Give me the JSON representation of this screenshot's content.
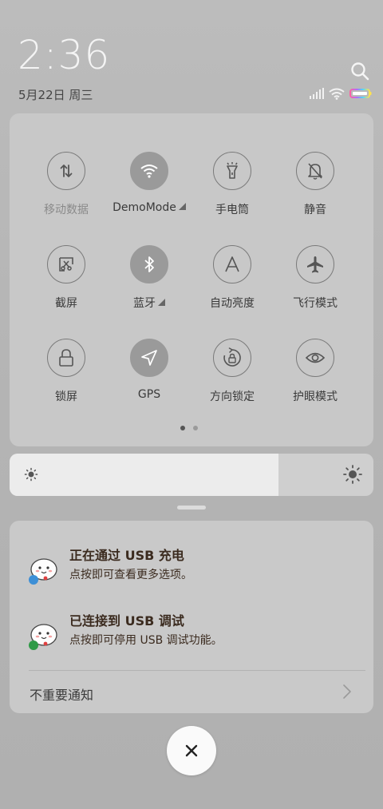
{
  "status": {
    "time": "2:36",
    "date": "5月22日 周三"
  },
  "quick_settings": {
    "tiles": [
      {
        "label": "移动数据",
        "icon": "mobile-data-icon",
        "active": false,
        "dimmed": true,
        "has_more": false
      },
      {
        "label": "DemoMode",
        "icon": "wifi-icon",
        "active": true,
        "dimmed": false,
        "has_more": true
      },
      {
        "label": "手电筒",
        "icon": "flashlight-icon",
        "active": false,
        "dimmed": false,
        "has_more": false
      },
      {
        "label": "静音",
        "icon": "bell-off-icon",
        "active": false,
        "dimmed": false,
        "has_more": false
      },
      {
        "label": "截屏",
        "icon": "screenshot-icon",
        "active": false,
        "dimmed": false,
        "has_more": false
      },
      {
        "label": "蓝牙",
        "icon": "bluetooth-icon",
        "active": true,
        "dimmed": false,
        "has_more": true
      },
      {
        "label": "自动亮度",
        "icon": "auto-brightness-icon",
        "active": false,
        "dimmed": false,
        "has_more": false
      },
      {
        "label": "飞行模式",
        "icon": "airplane-icon",
        "active": false,
        "dimmed": false,
        "has_more": false
      },
      {
        "label": "锁屏",
        "icon": "lock-icon",
        "active": false,
        "dimmed": false,
        "has_more": false
      },
      {
        "label": "GPS",
        "icon": "location-icon",
        "active": true,
        "dimmed": false,
        "has_more": false
      },
      {
        "label": "方向锁定",
        "icon": "rotation-lock-icon",
        "active": false,
        "dimmed": false,
        "has_more": false
      },
      {
        "label": "护眼模式",
        "icon": "eye-icon",
        "active": false,
        "dimmed": false,
        "has_more": false
      }
    ],
    "page_count": 2,
    "current_page": 0
  },
  "brightness": {
    "level": 0.74
  },
  "notifications": [
    {
      "title": "正在通过 USB 充电",
      "body": "点按即可查看更多选项。",
      "badge_color": "#3d8fd6"
    },
    {
      "title": "已连接到 USB 调试",
      "body": "点按即可停用 USB 调试功能。",
      "badge_color": "#2f9a47"
    }
  ],
  "unimportant_label": "不重要通知",
  "colors": {
    "panel": "#c8c8c8",
    "active_tile": "#9a9a9a"
  }
}
